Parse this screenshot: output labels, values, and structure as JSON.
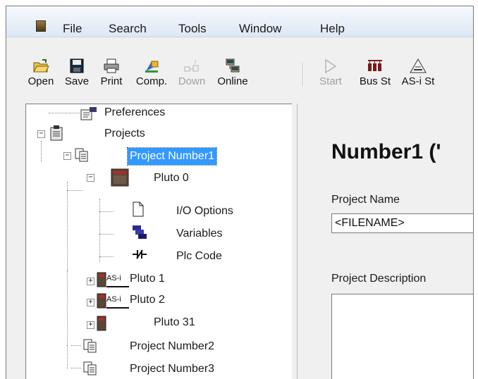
{
  "menu": {
    "items": [
      "File",
      "Search",
      "Tools",
      "Window",
      "Help"
    ]
  },
  "toolbar": {
    "buttons": [
      {
        "label": "Open",
        "icon": "open-folder-icon",
        "enabled": true
      },
      {
        "label": "Save",
        "icon": "floppy-disk-icon",
        "enabled": true
      },
      {
        "label": "Print",
        "icon": "printer-icon",
        "enabled": true
      },
      {
        "label": "Comp.",
        "icon": "compile-icon",
        "enabled": true
      },
      {
        "label": "Down",
        "icon": "download-icon",
        "enabled": false
      },
      {
        "label": "Online",
        "icon": "online-icon",
        "enabled": true
      },
      {
        "label": "Start",
        "icon": "play-icon",
        "enabled": false
      },
      {
        "label": "Bus St",
        "icon": "bus-status-icon",
        "enabled": true
      },
      {
        "label": "AS-i St",
        "icon": "asi-status-icon",
        "enabled": true
      }
    ]
  },
  "tree": {
    "preferences": "Preferences",
    "projects": "Projects",
    "project1": "Project Number1",
    "pluto0": "Pluto 0",
    "io_options": "I/O Options",
    "variables": "Variables",
    "plc_code": "Plc Code",
    "pluto1": "Pluto 1",
    "pluto2": "Pluto 2",
    "pluto31": "Pluto 31",
    "project2": "Project Number2",
    "project3": "Project Number3",
    "asi_badge": "AS-i"
  },
  "details": {
    "title": "Number1 ('",
    "project_name_label": "Project Name",
    "project_name_value": "<FILENAME>",
    "project_description_label": "Project Description"
  },
  "colors": {
    "selection": "#3399ff",
    "menubar_top": "#f6f9fd",
    "menubar_bottom": "#dde8f5",
    "panel_bg": "#f0f0f0"
  }
}
